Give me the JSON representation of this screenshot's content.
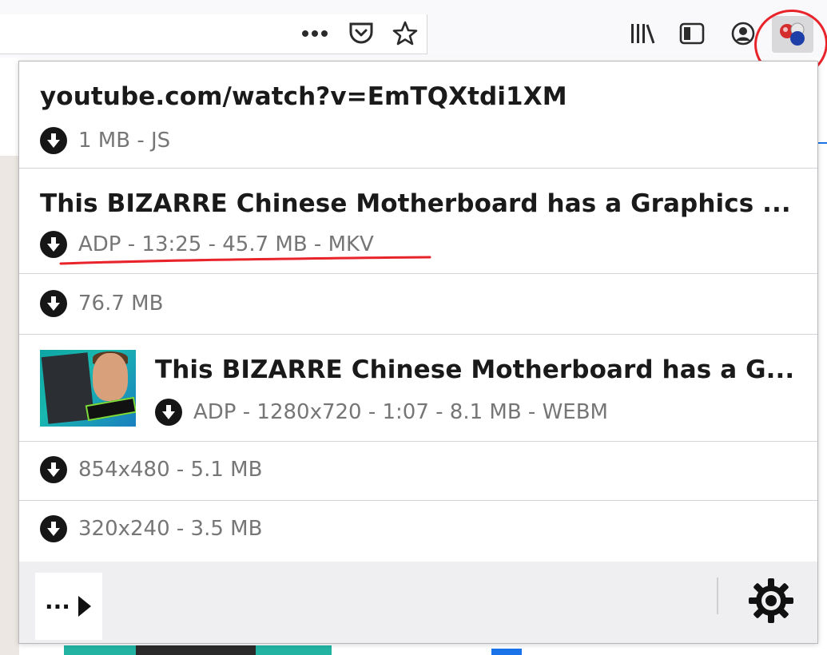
{
  "toolbar": {
    "icons": [
      "more-actions-icon",
      "pocket-icon",
      "bookmark-star-icon",
      "library-icon",
      "sidebar-icon",
      "account-icon",
      "video-downloadhelper-icon"
    ]
  },
  "popup": {
    "rows": [
      {
        "title": "youtube.com/watch?v=EmTQXtdi1XM",
        "subtitle": "1 MB - JS"
      },
      {
        "title": "This BIZARRE Chinese Motherboard has a Graphics ...",
        "subtitle": "ADP - 13:25 - 45.7 MB - MKV"
      },
      {
        "title": "",
        "subtitle": "76.7 MB"
      },
      {
        "title": "This BIZARRE Chinese Motherboard has a G...",
        "subtitle": "ADP - 1280x720 - 1:07 - 8.1 MB - WEBM"
      },
      {
        "title": "",
        "subtitle": "854x480 - 5.1 MB"
      },
      {
        "title": "",
        "subtitle": "320x240 - 3.5 MB"
      }
    ],
    "footer": {
      "more_label": "..."
    }
  },
  "colors": {
    "annotation_red": "#e8232a",
    "panel_border": "#b8b8bc",
    "subtitle_gray": "#767676",
    "icon_dark": "#161616"
  }
}
